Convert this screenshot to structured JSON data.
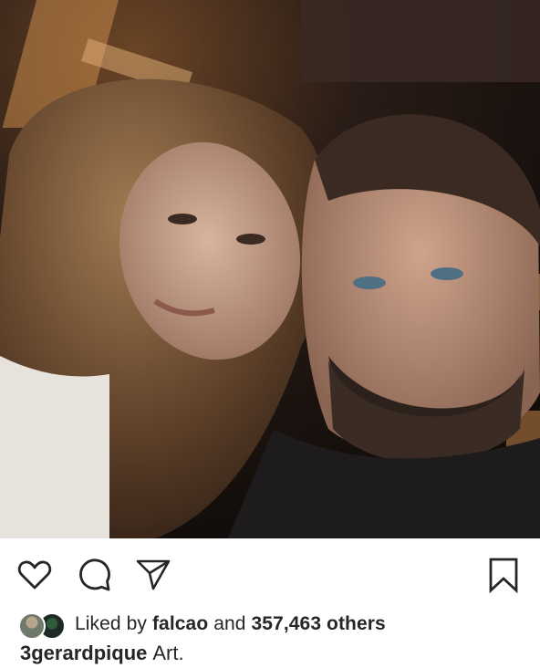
{
  "post": {
    "image_alt": "Selfie photo",
    "actions": {
      "like_icon": "heart-outline",
      "comment_icon": "speech-bubble-outline",
      "share_icon": "paper-plane-outline",
      "save_icon": "bookmark-outline"
    },
    "likes": {
      "prefix": "Liked by",
      "first_user": "falcao",
      "connector": "and",
      "others_count": "357,463 others"
    },
    "caption": {
      "username": "3gerardpique",
      "text": "Art."
    }
  }
}
